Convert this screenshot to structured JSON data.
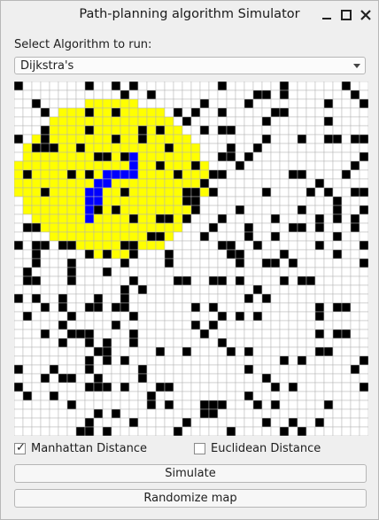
{
  "window": {
    "title": "Path-planning algorithm Simulator"
  },
  "algorithm": {
    "label": "Select Algorithm to run:",
    "selected": "Dijkstra's"
  },
  "grid": {
    "rows": 40,
    "cols": 40,
    "colors": {
      "free": "#ffffff",
      "wall": "#000000",
      "visited": "#ffff00",
      "path": "#0000ff",
      "gridline": "#b4b4b4"
    }
  },
  "options": {
    "manhattan": {
      "label": "Manhattan Distance",
      "checked": true
    },
    "euclidean": {
      "label": "Euclidean Distance",
      "checked": false
    }
  },
  "buttons": {
    "simulate": "Simulate",
    "randomize": "Randomize map"
  }
}
